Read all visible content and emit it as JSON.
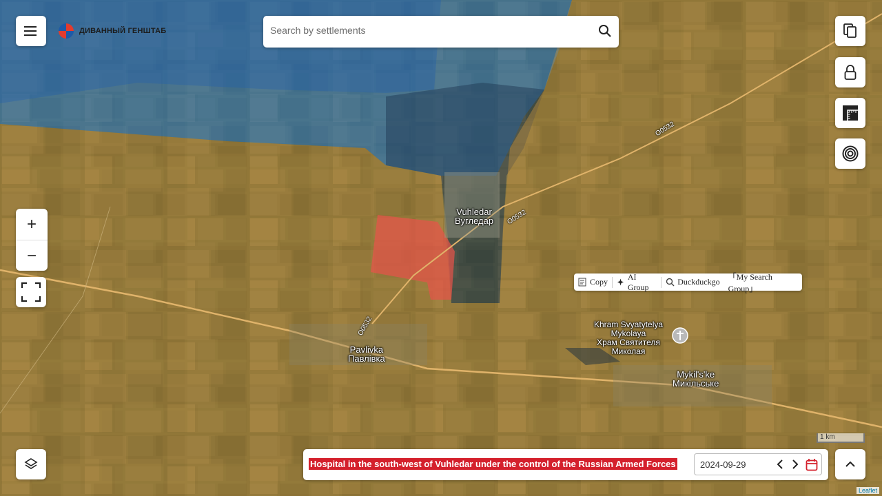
{
  "logo": {
    "text": "ДИВАННЫЙ ГЕНШТАБ"
  },
  "search": {
    "placeholder": "Search by settlements"
  },
  "zoom": {
    "in_label": "+",
    "out_label": "−"
  },
  "context_menu": {
    "copy": "Copy",
    "ai_group": "AI Group",
    "duckduckgo": "Duckduckgo",
    "search_group": "「My Search Group」"
  },
  "places": {
    "vuhledar": {
      "en": "Vuhledar",
      "ru": "Вугледар"
    },
    "pavlivka": {
      "en": "Pavlivka",
      "ru": "Павлівка"
    },
    "mykilske": {
      "en": "Mykil's'ke",
      "ru": "Микільське"
    },
    "khram": {
      "en1": "Khram Svyatytelya",
      "en2": "Mykolaya",
      "ru1": "Храм Святителя",
      "ru2": "Миколая"
    }
  },
  "roads": {
    "r1": "O0532",
    "r2": "O0532",
    "r3": "O0532"
  },
  "bottom": {
    "caption": "Hospital in the south-west of Vuhledar under the control of the Russian Armed Forces",
    "date": "2024-09-29"
  },
  "scale": "1 km",
  "attribution": "Leaflet",
  "colors": {
    "ukraine": "#2d7fd0",
    "russia": "#d99a3a",
    "captured": "#e8534a",
    "caption_bg": "#d4202c"
  },
  "icons": [
    "menu-icon",
    "search-icon",
    "copy-icon",
    "lock-icon",
    "ruler-icon",
    "target-icon",
    "fullscreen-icon",
    "layers-icon",
    "chevron-up-icon",
    "chevron-left-icon",
    "chevron-right-icon",
    "calendar-icon",
    "church-icon"
  ]
}
